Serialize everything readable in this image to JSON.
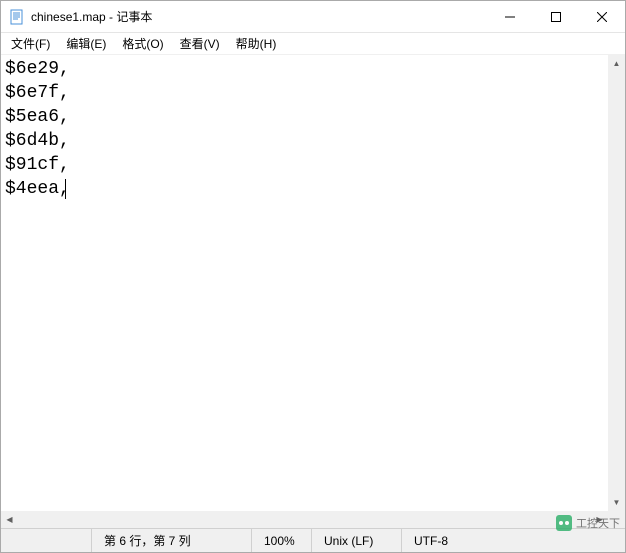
{
  "window": {
    "title": "chinese1.map - 记事本"
  },
  "menus": {
    "file": "文件(F)",
    "edit": "编辑(E)",
    "format": "格式(O)",
    "view": "查看(V)",
    "help": "帮助(H)"
  },
  "editor": {
    "lines": [
      "$6e29,",
      "$6e7f,",
      "$5ea6,",
      "$6d4b,",
      "$91cf,",
      "$4eea,"
    ]
  },
  "status": {
    "position": "第 6 行，第 7 列",
    "zoom": "100%",
    "lineending": "Unix (LF)",
    "encoding": "UTF-8"
  },
  "watermark": {
    "text": "工控天下"
  }
}
